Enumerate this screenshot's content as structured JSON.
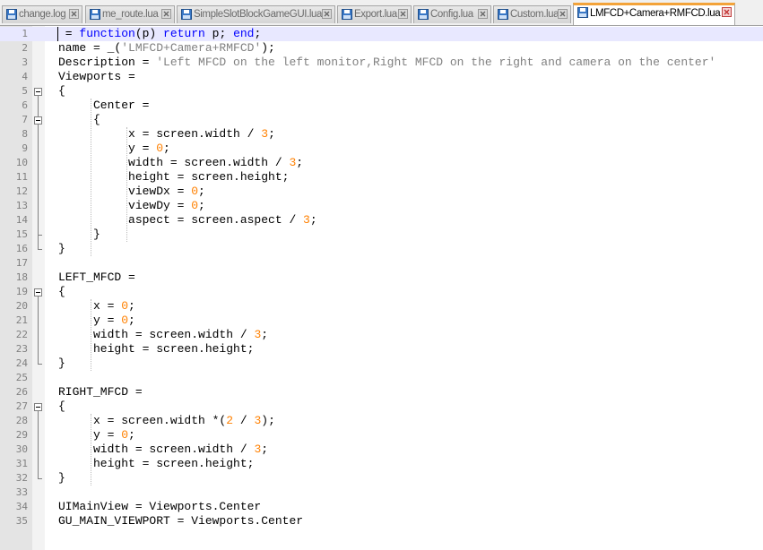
{
  "tabs": [
    {
      "label": "change.log",
      "active": false
    },
    {
      "label": "me_route.lua",
      "active": false
    },
    {
      "label": "SimpleSlotBlockGameGUI.lua",
      "active": false
    },
    {
      "label": "Export.lua",
      "active": false
    },
    {
      "label": "Config.lua",
      "active": false
    },
    {
      "label": "Custom.lua",
      "active": false
    },
    {
      "label": "LMFCD+Camera+RMFCD.lua",
      "active": true
    }
  ],
  "icons": {
    "file": "save-disk-icon",
    "close": "close-tab-icon",
    "fold": "fold-minus-icon"
  },
  "colors": {
    "keyword": "#0000ff",
    "string": "#808080",
    "number": "#ff8000",
    "operator": "#000080",
    "current_line": "#e8e8ff",
    "active_tab_accent": "#f3a33a"
  },
  "lines": [
    {
      "n": "1",
      "tokens": [
        [
          "t",
          " = "
        ],
        [
          "kw",
          "function"
        ],
        [
          "t",
          "(p) "
        ],
        [
          "kw",
          "return"
        ],
        [
          "t",
          " p; "
        ],
        [
          "kw",
          "end"
        ],
        [
          "t",
          ";"
        ]
      ]
    },
    {
      "n": "2",
      "tokens": [
        [
          "t",
          "name = _("
        ],
        [
          "str",
          "'LMFCD+Camera+RMFCD'"
        ],
        [
          "t",
          ");"
        ]
      ]
    },
    {
      "n": "3",
      "tokens": [
        [
          "t",
          "Description = "
        ],
        [
          "str",
          "'Left MFCD on the left monitor,Right MFCD on the right and camera on the center'"
        ]
      ]
    },
    {
      "n": "4",
      "tokens": [
        [
          "t",
          "Viewports = "
        ]
      ]
    },
    {
      "n": "5",
      "tokens": [
        [
          "t",
          "{"
        ]
      ]
    },
    {
      "n": "6",
      "tokens": [
        [
          "t",
          "     Center = "
        ]
      ]
    },
    {
      "n": "7",
      "tokens": [
        [
          "t",
          "     {"
        ]
      ]
    },
    {
      "n": "8",
      "tokens": [
        [
          "t",
          "          x = screen.width / "
        ],
        [
          "num",
          "3"
        ],
        [
          "t",
          ";"
        ]
      ]
    },
    {
      "n": "9",
      "tokens": [
        [
          "t",
          "          y = "
        ],
        [
          "num",
          "0"
        ],
        [
          "t",
          ";"
        ]
      ]
    },
    {
      "n": "10",
      "tokens": [
        [
          "t",
          "          width = screen.width / "
        ],
        [
          "num",
          "3"
        ],
        [
          "t",
          ";"
        ]
      ]
    },
    {
      "n": "11",
      "tokens": [
        [
          "t",
          "          height = screen.height;"
        ]
      ]
    },
    {
      "n": "12",
      "tokens": [
        [
          "t",
          "          viewDx = "
        ],
        [
          "num",
          "0"
        ],
        [
          "t",
          ";"
        ]
      ]
    },
    {
      "n": "13",
      "tokens": [
        [
          "t",
          "          viewDy = "
        ],
        [
          "num",
          "0"
        ],
        [
          "t",
          ";"
        ]
      ]
    },
    {
      "n": "14",
      "tokens": [
        [
          "t",
          "          aspect = screen.aspect / "
        ],
        [
          "num",
          "3"
        ],
        [
          "t",
          ";"
        ]
      ]
    },
    {
      "n": "15",
      "tokens": [
        [
          "t",
          "     }"
        ]
      ]
    },
    {
      "n": "16",
      "tokens": [
        [
          "t",
          "}"
        ]
      ]
    },
    {
      "n": "17",
      "tokens": []
    },
    {
      "n": "18",
      "tokens": [
        [
          "t",
          "LEFT_MFCD = "
        ]
      ]
    },
    {
      "n": "19",
      "tokens": [
        [
          "t",
          "{"
        ]
      ]
    },
    {
      "n": "20",
      "tokens": [
        [
          "t",
          "     x = "
        ],
        [
          "num",
          "0"
        ],
        [
          "t",
          ";"
        ]
      ]
    },
    {
      "n": "21",
      "tokens": [
        [
          "t",
          "     y = "
        ],
        [
          "num",
          "0"
        ],
        [
          "t",
          ";"
        ]
      ]
    },
    {
      "n": "22",
      "tokens": [
        [
          "t",
          "     width = screen.width / "
        ],
        [
          "num",
          "3"
        ],
        [
          "t",
          ";"
        ]
      ]
    },
    {
      "n": "23",
      "tokens": [
        [
          "t",
          "     height = screen.height;"
        ]
      ]
    },
    {
      "n": "24",
      "tokens": [
        [
          "t",
          "}"
        ]
      ]
    },
    {
      "n": "25",
      "tokens": []
    },
    {
      "n": "26",
      "tokens": [
        [
          "t",
          "RIGHT_MFCD = "
        ]
      ]
    },
    {
      "n": "27",
      "tokens": [
        [
          "t",
          "{"
        ]
      ]
    },
    {
      "n": "28",
      "tokens": [
        [
          "t",
          "     x = screen.width *("
        ],
        [
          "num",
          "2"
        ],
        [
          "t",
          " / "
        ],
        [
          "num",
          "3"
        ],
        [
          "t",
          ");"
        ]
      ]
    },
    {
      "n": "29",
      "tokens": [
        [
          "t",
          "     y = "
        ],
        [
          "num",
          "0"
        ],
        [
          "t",
          ";"
        ]
      ]
    },
    {
      "n": "30",
      "tokens": [
        [
          "t",
          "     width = screen.width / "
        ],
        [
          "num",
          "3"
        ],
        [
          "t",
          ";"
        ]
      ]
    },
    {
      "n": "31",
      "tokens": [
        [
          "t",
          "     height = screen.height;"
        ]
      ]
    },
    {
      "n": "32",
      "tokens": [
        [
          "t",
          "}"
        ]
      ]
    },
    {
      "n": "33",
      "tokens": []
    },
    {
      "n": "34",
      "tokens": [
        [
          "t",
          "UIMainView = Viewports.Center"
        ]
      ]
    },
    {
      "n": "35",
      "tokens": [
        [
          "t",
          "GU_MAIN_VIEWPORT = Viewports.Center"
        ]
      ]
    }
  ]
}
